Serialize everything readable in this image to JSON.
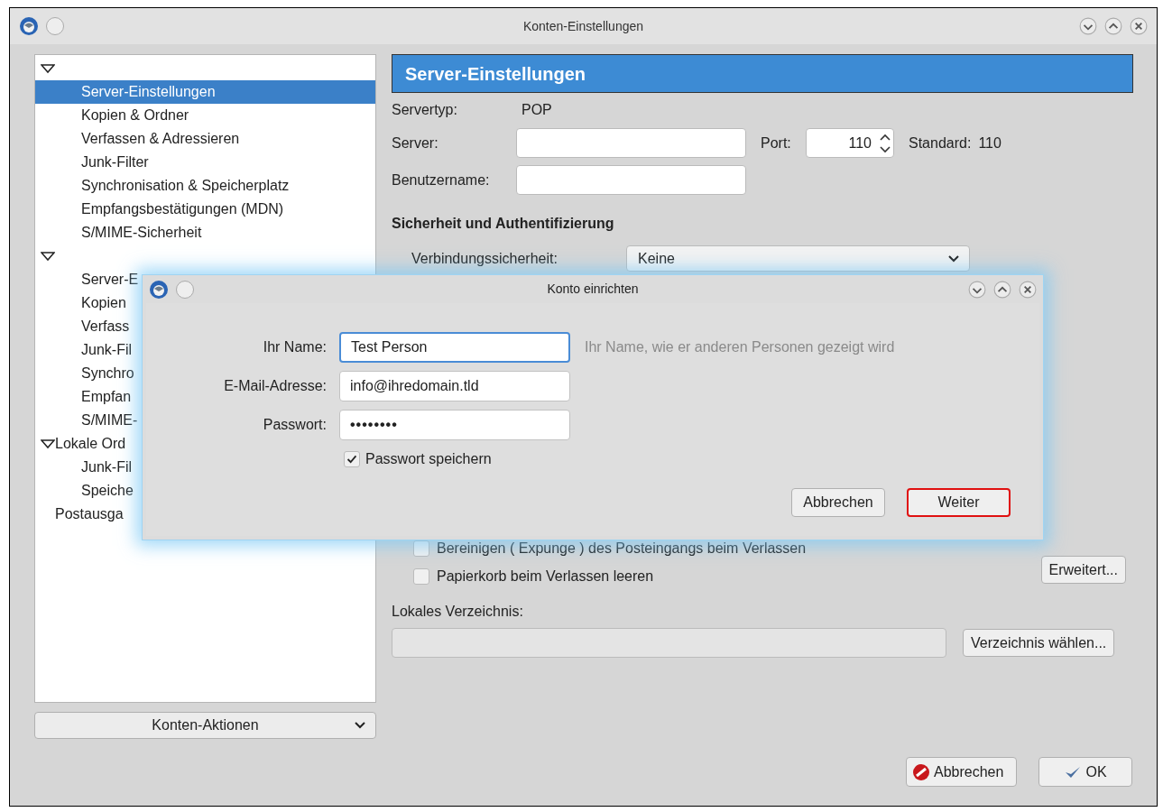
{
  "window": {
    "title": "Konten-Einstellungen"
  },
  "tree": [
    {
      "expanded": true,
      "children": [
        {
          "label": "Server-Einstellungen",
          "selected": true
        },
        {
          "label": "Kopien & Ordner",
          "selected": false
        },
        {
          "label": "Verfassen & Adressieren",
          "selected": false
        },
        {
          "label": "Junk-Filter",
          "selected": false
        },
        {
          "label": "Synchronisation & Speicherplatz",
          "selected": false
        },
        {
          "label": "Empfangsbestätigungen (MDN)",
          "selected": false
        },
        {
          "label": "S/MIME-Sicherheit",
          "selected": false
        }
      ]
    },
    {
      "expanded": true,
      "children": [
        {
          "label": "Server-E",
          "selected": false
        },
        {
          "label": "Kopien",
          "selected": false
        },
        {
          "label": "Verfass",
          "selected": false
        },
        {
          "label": "Junk-Fil",
          "selected": false
        },
        {
          "label": "Synchro",
          "selected": false
        },
        {
          "label": "Empfan",
          "selected": false
        },
        {
          "label": "S/MIME-",
          "selected": false
        }
      ]
    },
    {
      "label": "Lokale Ord",
      "expanded": true,
      "children": [
        {
          "label": "Junk-Fil",
          "selected": false
        },
        {
          "label": "Speiche",
          "selected": false
        }
      ]
    },
    {
      "label": "Postausga",
      "selected": false
    }
  ],
  "account_actions": "Konten-Aktionen",
  "panel": {
    "title": "Server-Einstellungen",
    "server_type_label": "Servertyp:",
    "server_type": "POP",
    "server_label": "Server:",
    "port_label": "Port:",
    "port_value": "110",
    "default_label": "Standard:",
    "default_value": "110",
    "username_label": "Benutzername:",
    "security_heading": "Sicherheit und Authentifizierung",
    "connection_label": "Verbindungssicherheit:",
    "connection_value": "Keine",
    "checkboxes": [
      {
        "label": "Bereinigen ( Expunge ) des Posteingangs beim Verlassen",
        "checked": false
      },
      {
        "label": "Papierkorb beim Verlassen leeren",
        "checked": false
      }
    ],
    "advanced_button": "Erweitert...",
    "local_dir_label": "Lokales Verzeichnis:",
    "choose_dir_button": "Verzeichnis wählen..."
  },
  "footer_buttons": [
    {
      "kind": "cancel",
      "label": "Abbrechen"
    },
    {
      "kind": "ok",
      "label": "OK"
    }
  ],
  "dialog": {
    "title": "Konto einrichten",
    "fields": [
      {
        "label": "Ihr Name:",
        "value": "Test Person",
        "kind": "text",
        "focused": true,
        "hint": "Ihr Name, wie er anderen Personen gezeigt wird"
      },
      {
        "label": "E-Mail-Adresse:",
        "value": "info@ihredomain.tld",
        "kind": "text",
        "focused": false
      },
      {
        "label": "Passwort:",
        "value": "••••••••",
        "kind": "password",
        "focused": false
      }
    ],
    "remember": {
      "label": "Passwort speichern",
      "checked": true
    },
    "buttons": [
      {
        "label": "Abbrechen",
        "highlighted": false
      },
      {
        "label": "Weiter",
        "highlighted": true
      }
    ]
  }
}
